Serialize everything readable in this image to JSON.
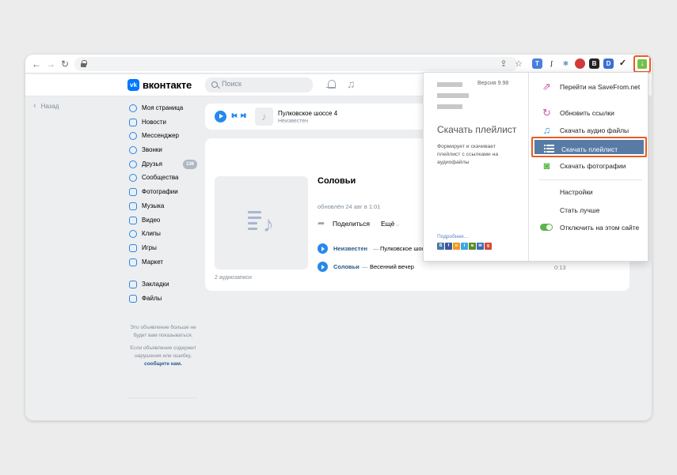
{
  "vk": {
    "brand": "вконтакте",
    "logo_text": "vk",
    "search_placeholder": "Поиск",
    "back_label": "Назад"
  },
  "nav": {
    "items": [
      {
        "label": "Моя страница",
        "icon": "user-icon"
      },
      {
        "label": "Новости",
        "icon": "news-icon"
      },
      {
        "label": "Мессенджер",
        "icon": "messenger-icon"
      },
      {
        "label": "Звонки",
        "icon": "phone-icon"
      },
      {
        "label": "Друзья",
        "icon": "friends-icon",
        "badge": "136"
      },
      {
        "label": "Сообщества",
        "icon": "groups-icon"
      },
      {
        "label": "Фотографии",
        "icon": "photo-icon"
      },
      {
        "label": "Музыка",
        "icon": "music-icon"
      },
      {
        "label": "Видео",
        "icon": "video-icon"
      },
      {
        "label": "Клипы",
        "icon": "clips-icon"
      },
      {
        "label": "Игры",
        "icon": "games-icon"
      },
      {
        "label": "Маркет",
        "icon": "market-icon"
      }
    ],
    "extra_items": [
      {
        "label": "Закладки",
        "icon": "bookmark-icon"
      },
      {
        "label": "Файлы",
        "icon": "file-icon"
      }
    ]
  },
  "ad": {
    "notice": "Это объявление больше не будет вам показываться.",
    "report_text": "Если объявление содержит нарушения или ошибку,",
    "report_link": "сообщите нам."
  },
  "player": {
    "title": "Пулковское шоссе 4",
    "artist": "Неизвестен"
  },
  "playlist": {
    "title": "Соловьи",
    "updated": "обновлён 24 авг в 1:01",
    "share_label": "Поделиться",
    "more_label": "Ещё",
    "tracks": [
      {
        "artist": "Неизвестен",
        "dash": "—",
        "title": "Пулковское шоссе"
      },
      {
        "artist": "Соловьи",
        "dash": "—",
        "title": "Весенний вечер"
      }
    ],
    "visible_duration": "0:13",
    "count_label": "2 аудиозаписи"
  },
  "savefrom": {
    "version": "Версия 9.98",
    "big_title": "Скачать плейлист",
    "description": "Формирует и скачивает плейлист с ссылками на аудиофайлы",
    "more_link": "Подробнее...",
    "social": [
      {
        "letter": "В",
        "color": "#4a76a8"
      },
      {
        "letter": "f",
        "color": "#3b5998"
      },
      {
        "letter": "о",
        "color": "#f39a1e"
      },
      {
        "letter": "t",
        "color": "#3aa8e1"
      },
      {
        "letter": "м",
        "color": "#5b8c2a"
      },
      {
        "letter": "✉",
        "color": "#3c6db0"
      },
      {
        "letter": "g",
        "color": "#d24a39"
      }
    ],
    "menu": [
      {
        "label": "Перейти на SaveFrom.net",
        "icon": "external-link-icon",
        "color": "#c75aa8"
      },
      {
        "label": "Обновить ссылки",
        "icon": "refresh-icon",
        "color": "#c75aa8"
      },
      {
        "label": "Скачать аудио файлы",
        "icon": "music-note-icon",
        "color": "#3c9ad6"
      },
      {
        "label": "Скачать плейлист",
        "icon": "list-icon",
        "active": true
      },
      {
        "label": "Скачать фотографии",
        "icon": "camera-icon",
        "color": "#5ab54a"
      },
      {
        "label": "Настройки",
        "icon": ""
      },
      {
        "label": "Стать лучше",
        "icon": ""
      },
      {
        "label": "Отключить на этом сайте",
        "icon": "toggle-icon",
        "color": "#5ab54a"
      }
    ]
  },
  "colors": {
    "accent": "#2688eb",
    "highlight": "#ec5b1e",
    "menu_active": "#577ba5"
  }
}
